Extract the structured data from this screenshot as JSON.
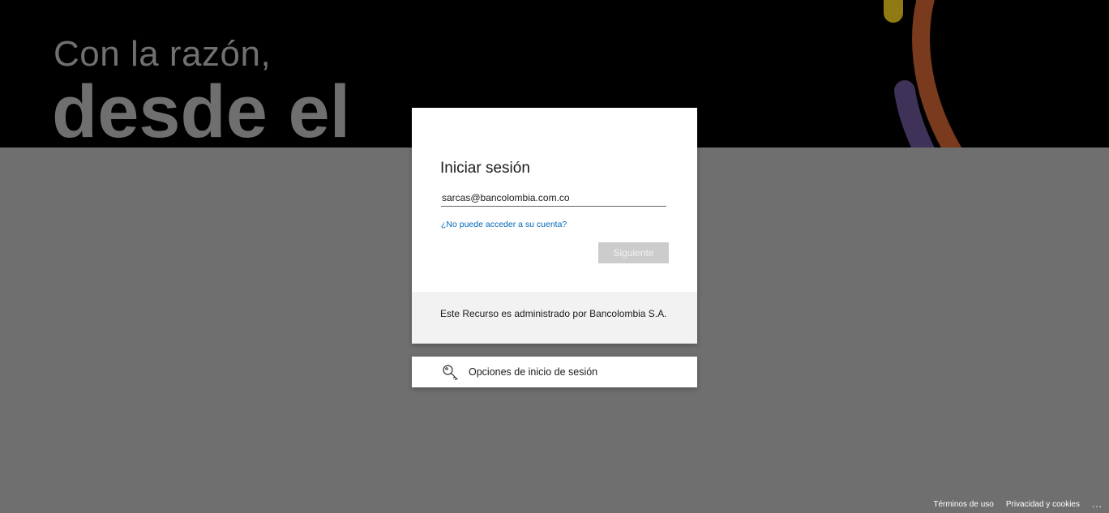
{
  "hero": {
    "line1": "Con la razón,",
    "line2": "desde el"
  },
  "signin": {
    "title": "Iniciar sesión",
    "email_value": "sarcas@bancolombia.com.co",
    "cant_access_link": "¿No puede acceder a su cuenta?",
    "next_button": "Siguiente",
    "footer_text": "Este Recurso es administrado por Bancolombia S.A."
  },
  "options": {
    "label": "Opciones de inicio de sesión",
    "icon": "key-icon"
  },
  "footer": {
    "terms": "Términos de uso",
    "privacy": "Privacidad y cookies",
    "more": "..."
  },
  "colors": {
    "link": "#0067b8",
    "page_background": "#6f6f6f",
    "hero_background": "#000000",
    "button_disabled": "#cccccc"
  }
}
